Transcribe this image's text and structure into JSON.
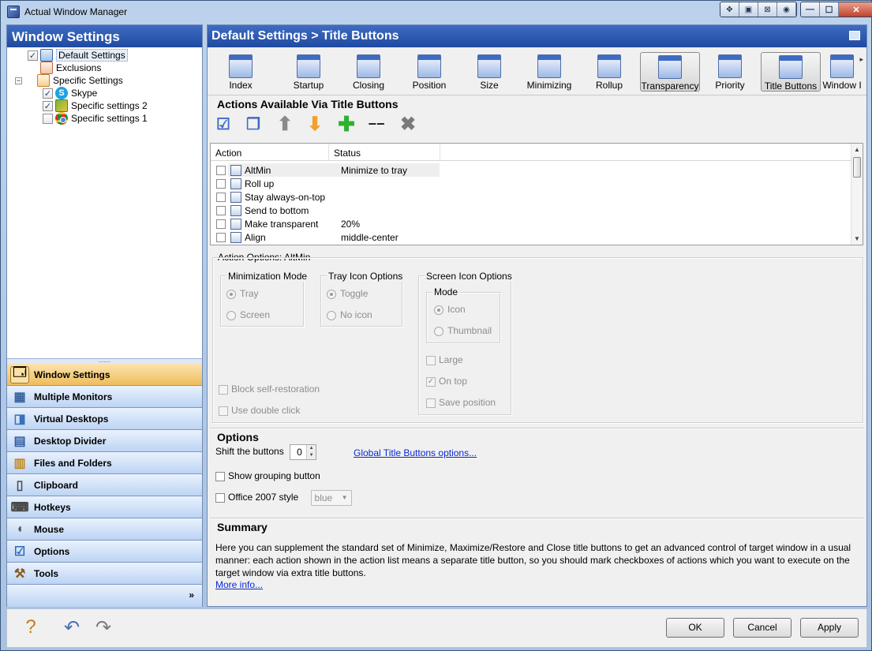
{
  "window": {
    "title": "Actual Window Manager",
    "title_buttons": [
      "✥",
      "▣",
      "⊠",
      "◉"
    ],
    "controls": [
      "—",
      "☐",
      "✕"
    ]
  },
  "left_panel": {
    "title": "Window Settings",
    "tree": [
      {
        "label": "Default Settings",
        "checked": true
      },
      {
        "label": "Exclusions"
      },
      {
        "label": "Specific Settings",
        "expander": "−"
      },
      {
        "label": "Skype",
        "checked": true
      },
      {
        "label": "Specific settings 2",
        "checked": true
      },
      {
        "label": "Specific settings 1",
        "checked": false
      }
    ],
    "nav": [
      {
        "label": "Window Settings",
        "icon": "window-settings-icon"
      },
      {
        "label": "Multiple Monitors",
        "icon": "monitors-icon"
      },
      {
        "label": "Virtual Desktops",
        "icon": "virtual-desktops-icon"
      },
      {
        "label": "Desktop Divider",
        "icon": "desktop-divider-icon"
      },
      {
        "label": "Files and Folders",
        "icon": "folders-icon"
      },
      {
        "label": "Clipboard",
        "icon": "clipboard-icon"
      },
      {
        "label": "Hotkeys",
        "icon": "keyboard-icon"
      },
      {
        "label": "Mouse",
        "icon": "mouse-icon"
      },
      {
        "label": "Options",
        "icon": "options-icon"
      },
      {
        "label": "Tools",
        "icon": "tools-icon"
      }
    ],
    "nav_more": "»",
    "splitter": "......."
  },
  "right_panel": {
    "breadcrumb": "Default Settings > Title Buttons",
    "toolbar": [
      "Index",
      "Startup",
      "Closing",
      "Position",
      "Size",
      "Minimizing",
      "Rollup",
      "Transparency",
      "Priority",
      "Title Buttons",
      "Window I"
    ],
    "toolbar_more": "▸",
    "actions_title": "Actions Available Via Title Buttons",
    "action_buttons": [
      "☑",
      "❐",
      "⬆",
      "⬇",
      "✚",
      "−−",
      "✖"
    ],
    "grid": {
      "columns": [
        "Action",
        "Status"
      ],
      "rows": [
        {
          "action": "AltMin",
          "status": "Minimize to tray"
        },
        {
          "action": "Roll up",
          "status": ""
        },
        {
          "action": "Stay always-on-top",
          "status": ""
        },
        {
          "action": "Send to bottom",
          "status": ""
        },
        {
          "action": "Make transparent",
          "status": "20%"
        },
        {
          "action": "Align",
          "status": "middle-center"
        }
      ],
      "scroll_up": "▲",
      "scroll_down": "▼"
    },
    "action_options": {
      "title": "Action Options: AltMin",
      "minimization_mode": {
        "title": "Minimization Mode",
        "options": [
          "Tray",
          "Screen"
        ]
      },
      "tray_icon": {
        "title": "Tray Icon Options",
        "options": [
          "Toggle",
          "No icon"
        ]
      },
      "screen_icon": {
        "title": "Screen Icon Options",
        "mode_title": "Mode",
        "mode_options": [
          "Icon",
          "Thumbnail"
        ],
        "checks": [
          "Large",
          "On top",
          "Save position"
        ],
        "check_mark": "✓"
      },
      "block_self_restoration": "Block self-restoration",
      "use_double_click": "Use double click"
    },
    "options": {
      "title": "Options",
      "shift_label": "Shift the buttons",
      "shift_value": "0",
      "global_link": "Global Title Buttons options...",
      "grouping": "Show grouping button",
      "office": "Office 2007 style",
      "style_value": "blue"
    },
    "summary": {
      "title": "Summary",
      "text": "Here you can supplement the standard set of Minimize, Maximize/Restore and Close title buttons to get an advanced control of target window in a usual manner: each action shown in the action list means a separate title button, so you should mark checkboxes of actions which you want to execute on the target window via extra title buttons.",
      "more": "More info..."
    }
  },
  "bottom": {
    "icons": [
      "?",
      "↶",
      "↷"
    ],
    "ok": "OK",
    "cancel": "Cancel",
    "apply": "Apply"
  }
}
